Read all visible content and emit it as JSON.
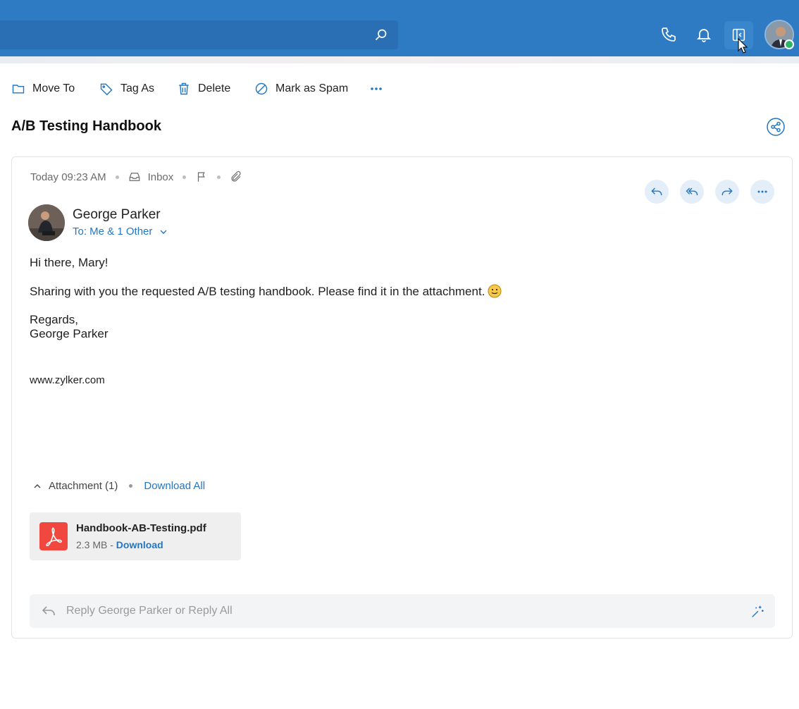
{
  "topbar": {
    "search_icon": "search-icon",
    "icons": [
      "phone-icon",
      "bell-icon",
      "panel-toggle-icon"
    ],
    "user_status": "online",
    "accent": "#2e7bc4"
  },
  "toolbar": {
    "move_to": "Move To",
    "tag_as": "Tag As",
    "delete": "Delete",
    "mark_spam": "Mark as Spam"
  },
  "email": {
    "subject": "A/B Testing Handbook",
    "time": "Today 09:23 AM",
    "folder": "Inbox",
    "sender": "George Parker",
    "recipients": "To: Me & 1 Other",
    "greeting": "Hi there, Mary!",
    "message": "Sharing with you the requested A/B testing handbook. Please find it in the attachment.",
    "sign_off": "Regards,",
    "signature_name": "George Parker",
    "website": "www.zylker.com"
  },
  "attachments": {
    "header": "Attachment (1)",
    "download_all": "Download All",
    "items": [
      {
        "name": "Handbook-AB-Testing.pdf",
        "size": "2.3 MB - ",
        "download": "Download"
      }
    ]
  },
  "reply": {
    "placeholder": "Reply George Parker or Reply All"
  }
}
